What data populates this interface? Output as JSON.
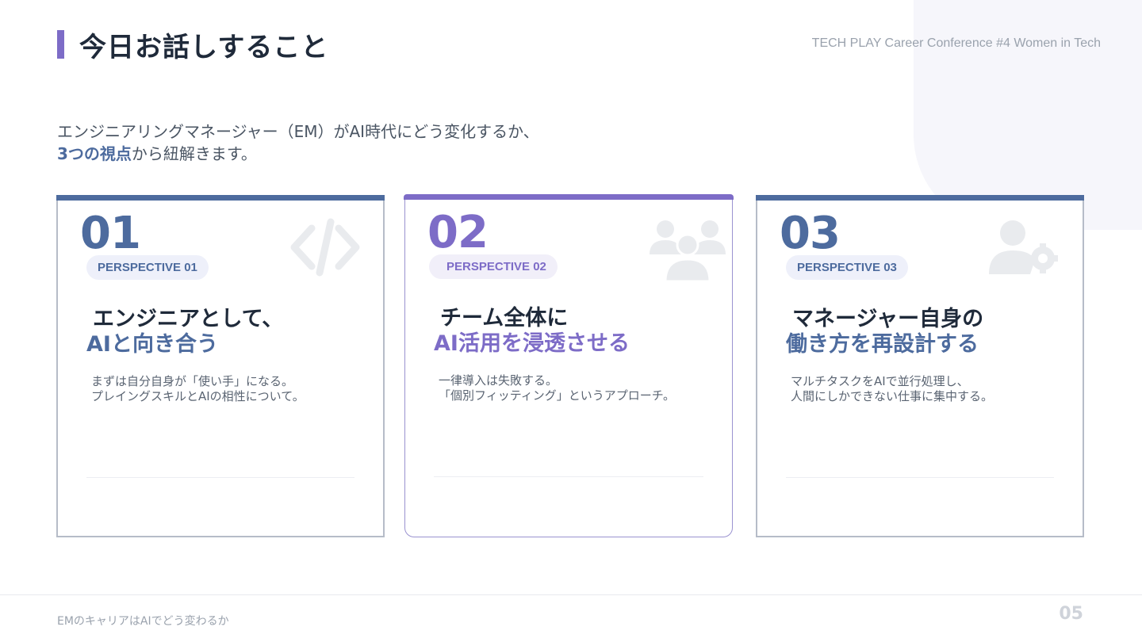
{
  "header": {
    "title": "今日お話しすること",
    "event": "TECH PLAY Career Conference #4 Women in Tech"
  },
  "intro": {
    "line1": "エンジニアリングマネージャー（EM）がAI時代にどう変化するか、",
    "highlight": "3つの視点",
    "line2_rest": "から紐解きます。"
  },
  "cards": [
    {
      "number": "01",
      "perspective": "PERSPECTIVE 01",
      "heading1": "エンジニアとして、",
      "heading2": "AIと向き合う",
      "desc1": "まずは自分自身が「使い手」になる。",
      "desc2": "プレイングスキルとAIの相性について。",
      "icon": "code-icon"
    },
    {
      "number": "02",
      "perspective": "PERSPECTIVE 02",
      "heading1": "チーム全体に",
      "heading2": "AI活用を浸透させる",
      "desc1": "一律導入は失敗する。",
      "desc2": "「個別フィッティング」というアプローチ。",
      "icon": "users-icon"
    },
    {
      "number": "03",
      "perspective": "PERSPECTIVE 03",
      "heading1": "マネージャー自身の",
      "heading2": "働き方を再設計する",
      "desc1": "マルチタスクをAIで並行処理し、",
      "desc2": "人間にしかできない仕事に集中する。",
      "icon": "user-gear-icon"
    }
  ],
  "footer": {
    "text": "EMのキャリアはAIでどう変わるか",
    "page": "05"
  },
  "colors": {
    "accent_blue": "#4d6b9e",
    "accent_purple": "#7d6cc7"
  }
}
